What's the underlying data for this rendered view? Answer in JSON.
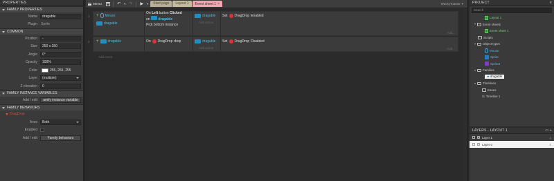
{
  "properties": {
    "header": "PROPERTIES",
    "family_section": "FAMILY PROPERTIES",
    "family_name_label": "Name",
    "family_name_value": "dragable",
    "plugin_label": "Plugin",
    "plugin_value": "Sprite",
    "common_section": "COMMON",
    "position_label": "Position",
    "position_value": "-",
    "size_label": "Size",
    "size_value": "250 x 250",
    "angle_label": "Angle",
    "angle_value": "0°",
    "opacity_label": "Opacity",
    "opacity_value": "100%",
    "color_label": "Color",
    "color_value": "255, 255, 255",
    "layer_label": "Layer",
    "layer_value": "(multiple)",
    "zelev_label": "Z elevation",
    "zelev_value": "0",
    "instvars_section": "FAMILY INSTANCE VARIABLES",
    "instvars_addedit_label": "Add / edit",
    "instvars_addedit_value": "amily instance variable",
    "behaviors_section": "FAMILY BEHAVIORS",
    "behavior_name": "DragDrop",
    "axes_label": "Axes",
    "axes_value": "Both",
    "enabled_label": "Enabled",
    "behaviors_addedit_label": "Add / edit",
    "behaviors_addedit_value": "Family behaviors"
  },
  "toolbar": {
    "menu_label": "MENU",
    "tabs": [
      "Start page",
      "Layout 1",
      "Event sheet 1"
    ],
    "active_tab_close": "×",
    "user": "WackyToaster"
  },
  "events": [
    {
      "number": "1",
      "conditions": [
        {
          "object": "Mouse",
          "text_pre": "On ",
          "text_bold": "Left",
          "text_mid": " button ",
          "text_bold2": "Clicked",
          "text_post": "on",
          "target": "dragable"
        },
        {
          "object": "dragable",
          "text": "Pick bottom instance"
        }
      ],
      "actions": [
        {
          "object": "dragable",
          "text": "Set",
          "behavior": "DragDrop",
          "value": "Enabled"
        }
      ],
      "add_action": "Add action",
      "add_link": "Add..."
    },
    {
      "number": "2",
      "conditions": [
        {
          "object": "dragable",
          "text": "On",
          "behavior": "DragDrop",
          "value": "drop"
        }
      ],
      "actions": [
        {
          "object": "dragable",
          "text": "Set",
          "behavior": "DragDrop",
          "value": "Disabled"
        }
      ],
      "add_action": "Add action",
      "add_link": "Add..."
    }
  ],
  "add_event": "Add event",
  "project": {
    "header": "PROJECT",
    "search_placeholder": "Search",
    "tree": [
      {
        "label": "Layout 1",
        "kind": "layout"
      },
      {
        "label": "Event sheets",
        "kind": "folder"
      },
      {
        "label": "Event sheet 1",
        "kind": "sheet"
      },
      {
        "label": "Scripts",
        "kind": "folder"
      },
      {
        "label": "Object types",
        "kind": "folder"
      },
      {
        "label": "Mouse",
        "kind": "mouse"
      },
      {
        "label": "Sprite",
        "kind": "sprite"
      },
      {
        "label": "Sprite2",
        "kind": "sprite2"
      },
      {
        "label": "Families",
        "kind": "folder"
      },
      {
        "label": "dragable",
        "kind": "family"
      },
      {
        "label": "Timelines",
        "kind": "folder"
      },
      {
        "label": "Eases",
        "kind": "folder"
      },
      {
        "label": "Timeline 1",
        "kind": "timeline"
      }
    ]
  },
  "layers": {
    "header": "LAYERS - LAYOUT 1",
    "rows": [
      {
        "name": "Layer 1",
        "num": "1"
      },
      {
        "name": "Layer 0",
        "num": "0"
      }
    ]
  },
  "colors": {
    "accent_pink": "#f3a6b0",
    "behavior_red": "#e04a3a",
    "object_teal": "#4fb7e0"
  }
}
